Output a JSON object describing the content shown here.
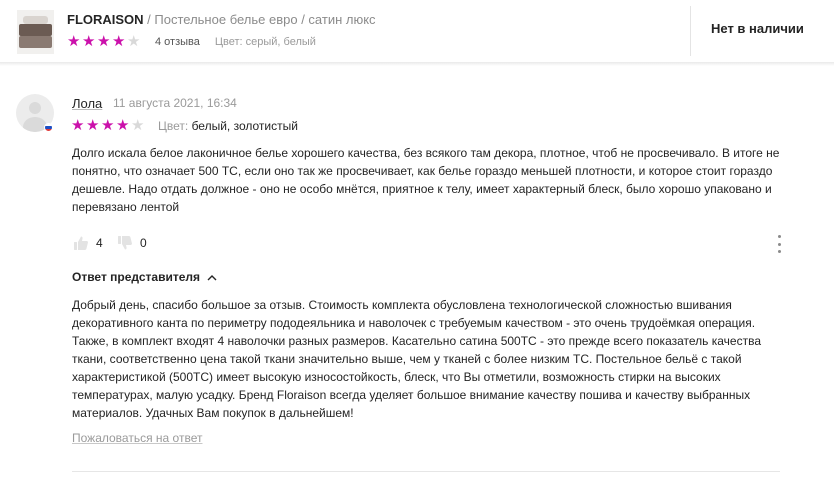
{
  "header": {
    "brand": "FLORAISON",
    "breadcrumb": " / Постельное белье евро / сатин люкс",
    "rating": 4,
    "reviews_count": "4 отзыва",
    "color": "Цвет: серый, белый",
    "stock": "Нет в наличии"
  },
  "review": {
    "author": "Лола",
    "date": "11 августа 2021, 16:34",
    "rating": 4,
    "color_label": "Цвет:",
    "color_value": " белый, золотистый",
    "text": "Долго искала белое лаконичное белье хорошего качества, без всякого там декора, плотное, чтоб не просвечивало. В итоге не понятно, что означает 500 ТС, если оно так же просвечивает, как белье гораздо меньшей плотности, и которое стоит гораздо дешевле. Надо отдать должное - оно не особо мнётся, приятное к телу, имеет характерный блеск, было хорошо упаковано и перевязано лентой",
    "likes": "4",
    "dislikes": "0"
  },
  "reply": {
    "heading": "Ответ представителя",
    "text": "Добрый день, спасибо большое за отзыв. Стоимость комплекта обусловлена технологической сложностью вшивания декоративного канта по периметру пододеяльника и наволочек с требуемым качеством - это очень трудоёмкая операция. Также, в комплект входят 4 наволочки разных размеров. Касательно сатина 500ТС - это прежде всего показатель качества ткани, соответственно цена такой ткани значительно выше, чем у тканей с более низким ТС. Постельное бельё с такой характеристикой (500ТС) имеет высокую износостойкость, блеск, что Вы отметили, возможность стирки на высоких температурах, малую усадку. Бренд Floraison всегда уделяет большое внимание качеству пошива и качеству выбранных материалов. Удачных Вам покупок в дальнейшем!",
    "complain": "Пожаловаться на ответ"
  },
  "colors": {
    "star_active": "#cb11ab",
    "star_inactive": "#d9d9d9"
  },
  "icons": [
    "star-icon",
    "thumb-up-icon",
    "thumb-down-icon",
    "more-vertical-icon",
    "chevron-up-icon",
    "russia-flag-icon"
  ]
}
